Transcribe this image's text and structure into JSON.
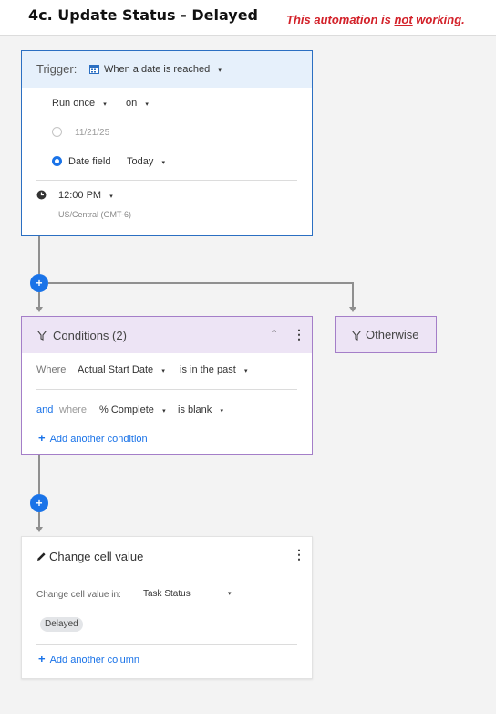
{
  "header": {
    "title": "4c. Update Status - Delayed",
    "note_prefix": "This automation is ",
    "note_emphasis": "not",
    "note_suffix": " working."
  },
  "trigger": {
    "label": "Trigger:",
    "type": "When a date is reached",
    "frequency": "Run once",
    "on": "on",
    "date_option": "11/21/25",
    "date_field_label": "Date field",
    "date_field_value": "Today",
    "time": "12:00 PM",
    "timezone": "US/Central (GMT-6)"
  },
  "conditions": {
    "title": "Conditions (2)",
    "rows": [
      {
        "prefix": "Where",
        "field": "Actual Start Date",
        "operator": "is in the past"
      },
      {
        "conjunction": "and",
        "prefix": "where",
        "field": "% Complete",
        "operator": "is blank"
      }
    ],
    "add_label": "Add another condition"
  },
  "otherwise": {
    "label": "Otherwise"
  },
  "action": {
    "title": "Change cell value",
    "change_label": "Change cell value in:",
    "column": "Task Status",
    "value": "Delayed",
    "add_label": "Add another column"
  },
  "icons": {
    "plus": "+",
    "caret": "▾",
    "kebab": "⋮",
    "chevron_up": "⌃"
  },
  "colors": {
    "accent": "#1a73e8",
    "trigger_border": "#2b6fc2",
    "trigger_head": "#e6f0fb",
    "condition_border": "#a47ec8",
    "condition_head": "#ede4f5",
    "note_red": "#d3222a"
  }
}
